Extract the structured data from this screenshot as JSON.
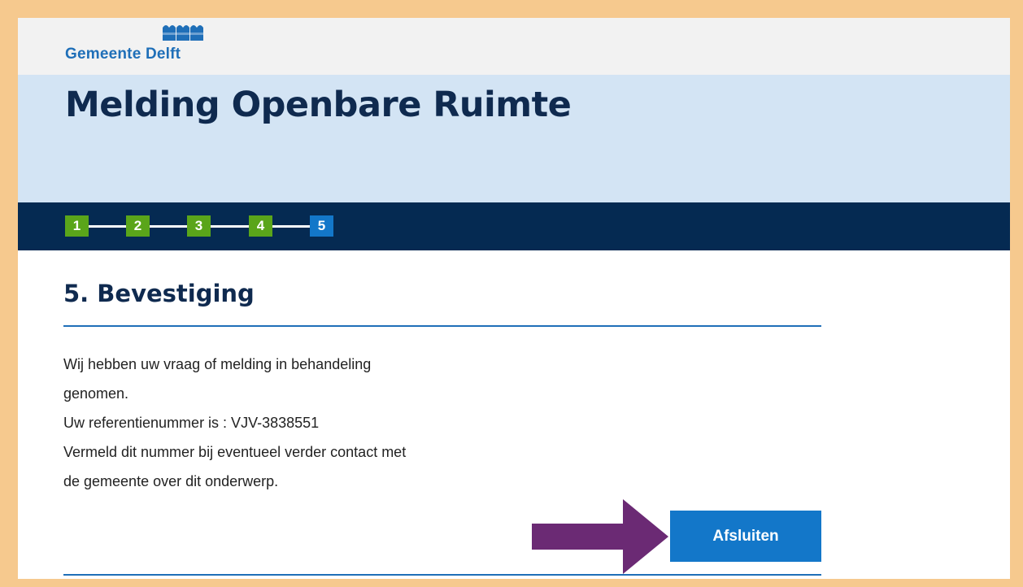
{
  "brand": {
    "name": "Gemeente Delft",
    "color": "#1f6fb8"
  },
  "hero": {
    "title": "Melding Openbare Ruimte"
  },
  "steps": [
    {
      "label": "1",
      "state": "done"
    },
    {
      "label": "2",
      "state": "done"
    },
    {
      "label": "3",
      "state": "done"
    },
    {
      "label": "4",
      "state": "done"
    },
    {
      "label": "5",
      "state": "current"
    }
  ],
  "section": {
    "title": "5. Bevestiging"
  },
  "message": {
    "line1": "Wij hebben uw vraag of melding in behandeling",
    "line2": "genomen.",
    "line3": "Uw referentienummer is : VJV-3838551",
    "line4": "Vermeld dit nummer bij eventueel verder contact met",
    "line5": "de gemeente over dit onderwerp."
  },
  "actions": {
    "close_label": "Afsluiten"
  },
  "colors": {
    "frame": "#f6c98e",
    "hero_bg": "#d3e4f4",
    "steps_bar": "#052a52",
    "step_done": "#5aa51a",
    "step_current": "#1377c9",
    "button": "#1377c9",
    "arrow": "#6b2a74"
  },
  "annotation": {
    "icon": "arrow-right-icon"
  }
}
